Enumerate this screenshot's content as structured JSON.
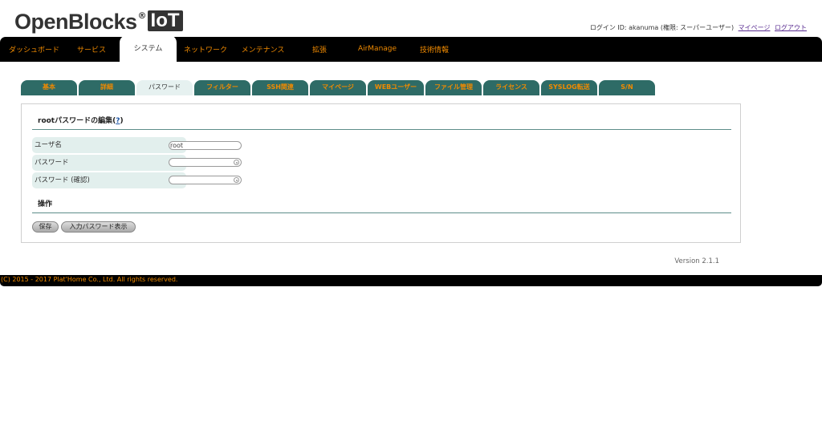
{
  "header": {
    "logo_text": "OpenBlocks",
    "logo_reg": "®",
    "logo_badge": "IoT",
    "user_info": "ログイン ID: akanuma (権限: スーパーユーザー)",
    "mypage_link": "マイページ",
    "logout_link": "ログアウト"
  },
  "nav": {
    "items": [
      {
        "label": "ダッシュボード"
      },
      {
        "label": "サービス"
      },
      {
        "label": "システム",
        "active": true
      },
      {
        "label": "ネットワーク"
      },
      {
        "label": "メンテナンス"
      },
      {
        "label": "拡張"
      },
      {
        "label": "AirManage"
      },
      {
        "label": "技術情報"
      }
    ]
  },
  "subtabs": {
    "items": [
      {
        "label": "基本"
      },
      {
        "label": "詳細"
      },
      {
        "label": "パスワード",
        "active": true
      },
      {
        "label": "フィルター"
      },
      {
        "label": "SSH関連"
      },
      {
        "label": "マイページ"
      },
      {
        "label": "WEBユーザー"
      },
      {
        "label": "ファイル管理"
      },
      {
        "label": "ライセンス"
      },
      {
        "label": "SYSLOG転送"
      },
      {
        "label": "S/N"
      }
    ]
  },
  "form": {
    "section_title": "rootパスワードの編集",
    "help_paren_open": "(",
    "help_link": "?",
    "help_paren_close": ")",
    "username_label": "ユーザ名",
    "username_value": "root",
    "password_label": "パスワード",
    "password_value": "",
    "password_confirm_label": "パスワード (確認)",
    "password_confirm_value": "",
    "operations_title": "操作",
    "save_button": "保存",
    "show_password_button": "入力パスワード表示"
  },
  "version": "Version 2.1.1",
  "footer": "(C) 2015 - 2017 Plat'Home Co., Ltd. All rights reserved.",
  "colors": {
    "nav_bg": "#000000",
    "accent_orange": "#f08a00",
    "tab_teal": "#2e6b66",
    "label_bg": "#e2efed"
  }
}
